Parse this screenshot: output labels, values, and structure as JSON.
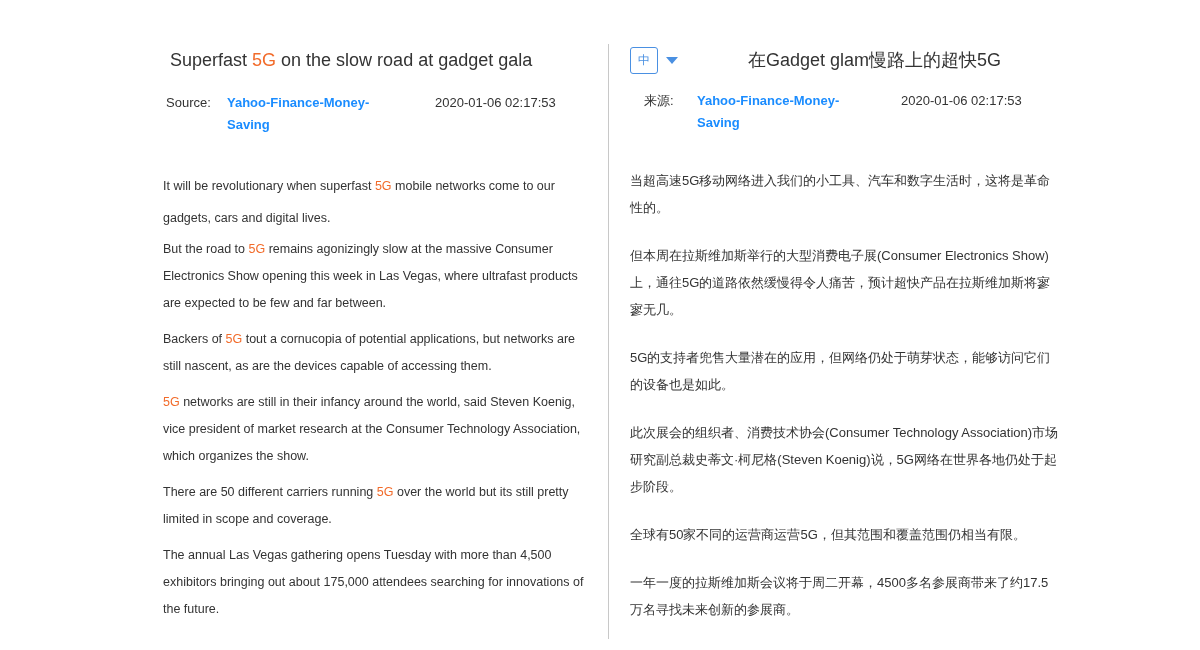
{
  "original": {
    "title": [
      {
        "text": "Superfast ",
        "highlight": false
      },
      {
        "text": "5G",
        "highlight": true
      },
      {
        "text": " on the slow road at gadget gala",
        "highlight": false
      }
    ],
    "source_label": "Source:",
    "source": "Yahoo-Finance-Money-Saving",
    "date": "2020-01-06 02:17:53",
    "paragraphs": [
      [
        {
          "text": "It will be revolutionary when superfast ",
          "highlight": false
        },
        {
          "text": "5G",
          "highlight": true
        },
        {
          "text": " mobile networks come to our gadgets, cars and digital lives.",
          "highlight": false
        }
      ],
      [
        {
          "text": "But the road to ",
          "highlight": false
        },
        {
          "text": "5G",
          "highlight": true
        },
        {
          "text": " remains agonizingly slow at the massive Consumer Electronics Show opening this week in Las Vegas, where ultrafast products are expected to be few and far between.",
          "highlight": false
        }
      ],
      [
        {
          "text": "Backers of ",
          "highlight": false
        },
        {
          "text": "5G",
          "highlight": true
        },
        {
          "text": " tout a cornucopia of potential applications, but networks are still nascent, as are the devices capable of accessing them.",
          "highlight": false
        }
      ],
      [
        {
          "text": "5G",
          "highlight": true
        },
        {
          "text": " networks are still in their infancy around the world, said Steven Koenig, vice president of market research at the Consumer Technology Association, which organizes the show.",
          "highlight": false
        }
      ],
      [
        {
          "text": "There are 50 different carriers running ",
          "highlight": false
        },
        {
          "text": "5G",
          "highlight": true
        },
        {
          "text": " over the world but its still pretty limited in scope and coverage.",
          "highlight": false
        }
      ],
      [
        {
          "text": "The annual Las Vegas gathering opens Tuesday with more than 4,500 exhibitors bringing out about 175,000 attendees searching for innovations of the future.",
          "highlight": false
        }
      ]
    ]
  },
  "translation": {
    "language_button": "中",
    "title": "在Gadget glam慢路上的超快5G",
    "source_label": "来源:",
    "source": "Yahoo-Finance-Money-Saving",
    "date": "2020-01-06 02:17:53",
    "paragraphs": [
      "当超高速5G移动网络进入我们的小工具、汽车和数字生活时，这将是革命性的。",
      "但本周在拉斯维加斯举行的大型消费电子展(Consumer Electronics Show)上，通往5G的道路依然缓慢得令人痛苦，预计超快产品在拉斯维加斯将寥寥无几。",
      "5G的支持者兜售大量潜在的应用，但网络仍处于萌芽状态，能够访问它们的设备也是如此。",
      "此次展会的组织者、消费技术协会(Consumer Technology Association)市场研究副总裁史蒂文·柯尼格(Steven Koenig)说，5G网络在世界各地仍处于起步阶段。",
      "全球有50家不同的运营商运营5G，但其范围和覆盖范围仍相当有限。",
      "一年一度的拉斯维加斯会议将于周二开幕，4500多名参展商带来了约17.5万名寻找未来创新的参展商。"
    ]
  }
}
